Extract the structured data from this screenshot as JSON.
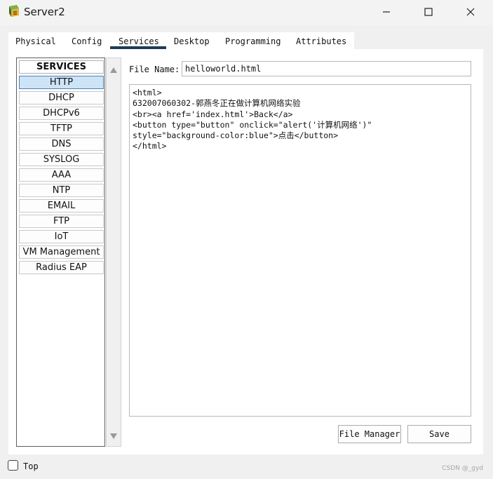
{
  "window": {
    "title": "Server2",
    "icons": [
      "server-app-icon",
      "minimize-icon",
      "maximize-icon",
      "close-icon"
    ]
  },
  "tabs": [
    {
      "label": "Physical",
      "active": false
    },
    {
      "label": "Config",
      "active": false
    },
    {
      "label": "Services",
      "active": true
    },
    {
      "label": "Desktop",
      "active": false
    },
    {
      "label": "Programming",
      "active": false
    },
    {
      "label": "Attributes",
      "active": false
    }
  ],
  "services": {
    "header": "SERVICES",
    "items": [
      {
        "label": "HTTP",
        "selected": true
      },
      {
        "label": "DHCP",
        "selected": false
      },
      {
        "label": "DHCPv6",
        "selected": false
      },
      {
        "label": "TFTP",
        "selected": false
      },
      {
        "label": "DNS",
        "selected": false
      },
      {
        "label": "SYSLOG",
        "selected": false
      },
      {
        "label": "AAA",
        "selected": false
      },
      {
        "label": "NTP",
        "selected": false
      },
      {
        "label": "EMAIL",
        "selected": false
      },
      {
        "label": "FTP",
        "selected": false
      },
      {
        "label": "IoT",
        "selected": false
      },
      {
        "label": "VM Management",
        "selected": false
      },
      {
        "label": "Radius EAP",
        "selected": false
      }
    ]
  },
  "http": {
    "file_name_label": "File Name:",
    "file_name_value": "helloworld.html",
    "content": "<html>\n632007060302-郭燕冬正在做计算机网络实验\n<br><a href='index.html'>Back</a>\n<button type=\"button\" onclick=\"alert('计算机网络')\"\nstyle=\"background-color:blue\">点击</button>\n</html>",
    "file_manager_label": "File Manager",
    "save_label": "Save"
  },
  "footer": {
    "top_label": "Top",
    "top_checked": false,
    "watermark": "CSDN @_gyd"
  },
  "colors": {
    "tab_underline": "#1f3b58",
    "selected_service_bg": "#cde4f7",
    "selected_service_border": "#4e7fb8"
  }
}
